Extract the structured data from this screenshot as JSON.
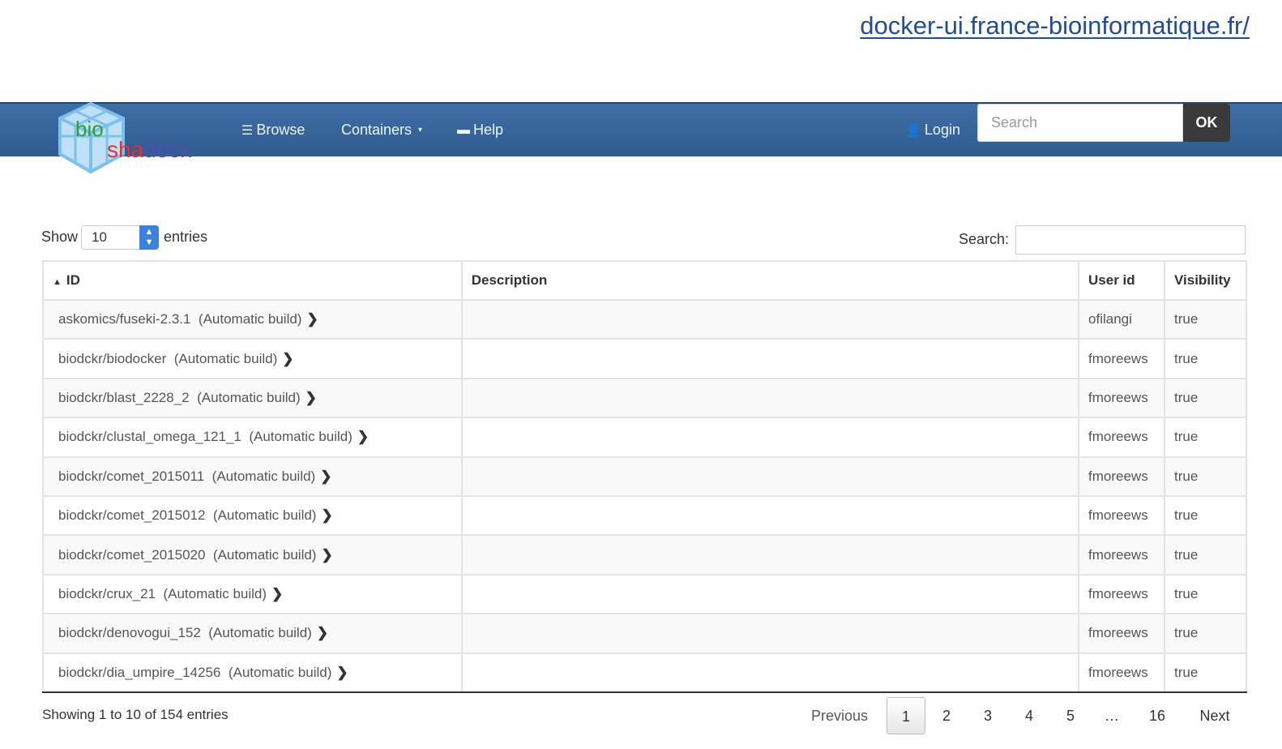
{
  "top_link": "docker-ui.france-bioinformatique.fr/",
  "logo": {
    "part1": "bio",
    "part2a": "sha",
    "part2b": "dock"
  },
  "navbar": {
    "browse": "Browse",
    "containers": "Containers",
    "help": "Help",
    "login": "Login",
    "search_placeholder": "Search",
    "ok": "OK"
  },
  "length": {
    "show": "Show",
    "value": "10",
    "entries": "entries"
  },
  "search_label": "Search:",
  "table": {
    "headers": {
      "id": "ID",
      "description": "Description",
      "user_id": "User id",
      "visibility": "Visibility"
    },
    "rows": [
      {
        "id": "askomics/fuseki-2.3.1",
        "build": "(Automatic build)",
        "description": "",
        "user": "ofilangi",
        "visibility": "true"
      },
      {
        "id": "biodckr/biodocker",
        "build": "(Automatic build)",
        "description": "",
        "user": "fmoreews",
        "visibility": "true"
      },
      {
        "id": "biodckr/blast_2228_2",
        "build": "(Automatic build)",
        "description": "",
        "user": "fmoreews",
        "visibility": "true"
      },
      {
        "id": "biodckr/clustal_omega_121_1",
        "build": "(Automatic build)",
        "description": "",
        "user": "fmoreews",
        "visibility": "true"
      },
      {
        "id": "biodckr/comet_2015011",
        "build": "(Automatic build)",
        "description": "",
        "user": "fmoreews",
        "visibility": "true"
      },
      {
        "id": "biodckr/comet_2015012",
        "build": "(Automatic build)",
        "description": "",
        "user": "fmoreews",
        "visibility": "true"
      },
      {
        "id": "biodckr/comet_2015020",
        "build": "(Automatic build)",
        "description": "",
        "user": "fmoreews",
        "visibility": "true"
      },
      {
        "id": "biodckr/crux_21",
        "build": "(Automatic build)",
        "description": "",
        "user": "fmoreews",
        "visibility": "true"
      },
      {
        "id": "biodckr/denovogui_152",
        "build": "(Automatic build)",
        "description": "",
        "user": "fmoreews",
        "visibility": "true"
      },
      {
        "id": "biodckr/dia_umpire_14256",
        "build": "(Automatic build)",
        "description": "",
        "user": "fmoreews",
        "visibility": "true"
      }
    ]
  },
  "info": "Showing 1 to 10 of 154 entries",
  "pagination": {
    "previous": "Previous",
    "pages": [
      "1",
      "2",
      "3",
      "4",
      "5",
      "…",
      "16"
    ],
    "next": "Next",
    "current": "1"
  },
  "colors": {
    "navbar": "#3a6aa2",
    "ok_button": "#3a3a3a",
    "link": "#1f4e97"
  }
}
